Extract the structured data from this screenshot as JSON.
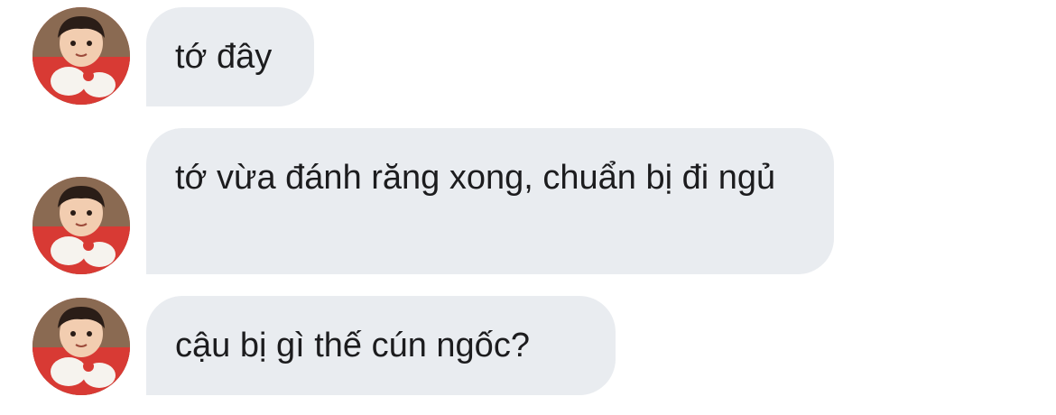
{
  "messages": [
    {
      "text": "tớ đây",
      "avatar": "child-photo-avatar"
    },
    {
      "text": "tớ vừa đánh răng xong, chuẩn bị đi ngủ",
      "avatar": "child-photo-avatar"
    },
    {
      "text": "cậu bị gì thế cún ngốc?",
      "avatar": "child-photo-avatar"
    }
  ],
  "colors": {
    "bubble_bg": "#e9ecf0",
    "text": "#1c1c1e",
    "avatar_shirt": "#d83a34",
    "background": "#ffffff"
  }
}
